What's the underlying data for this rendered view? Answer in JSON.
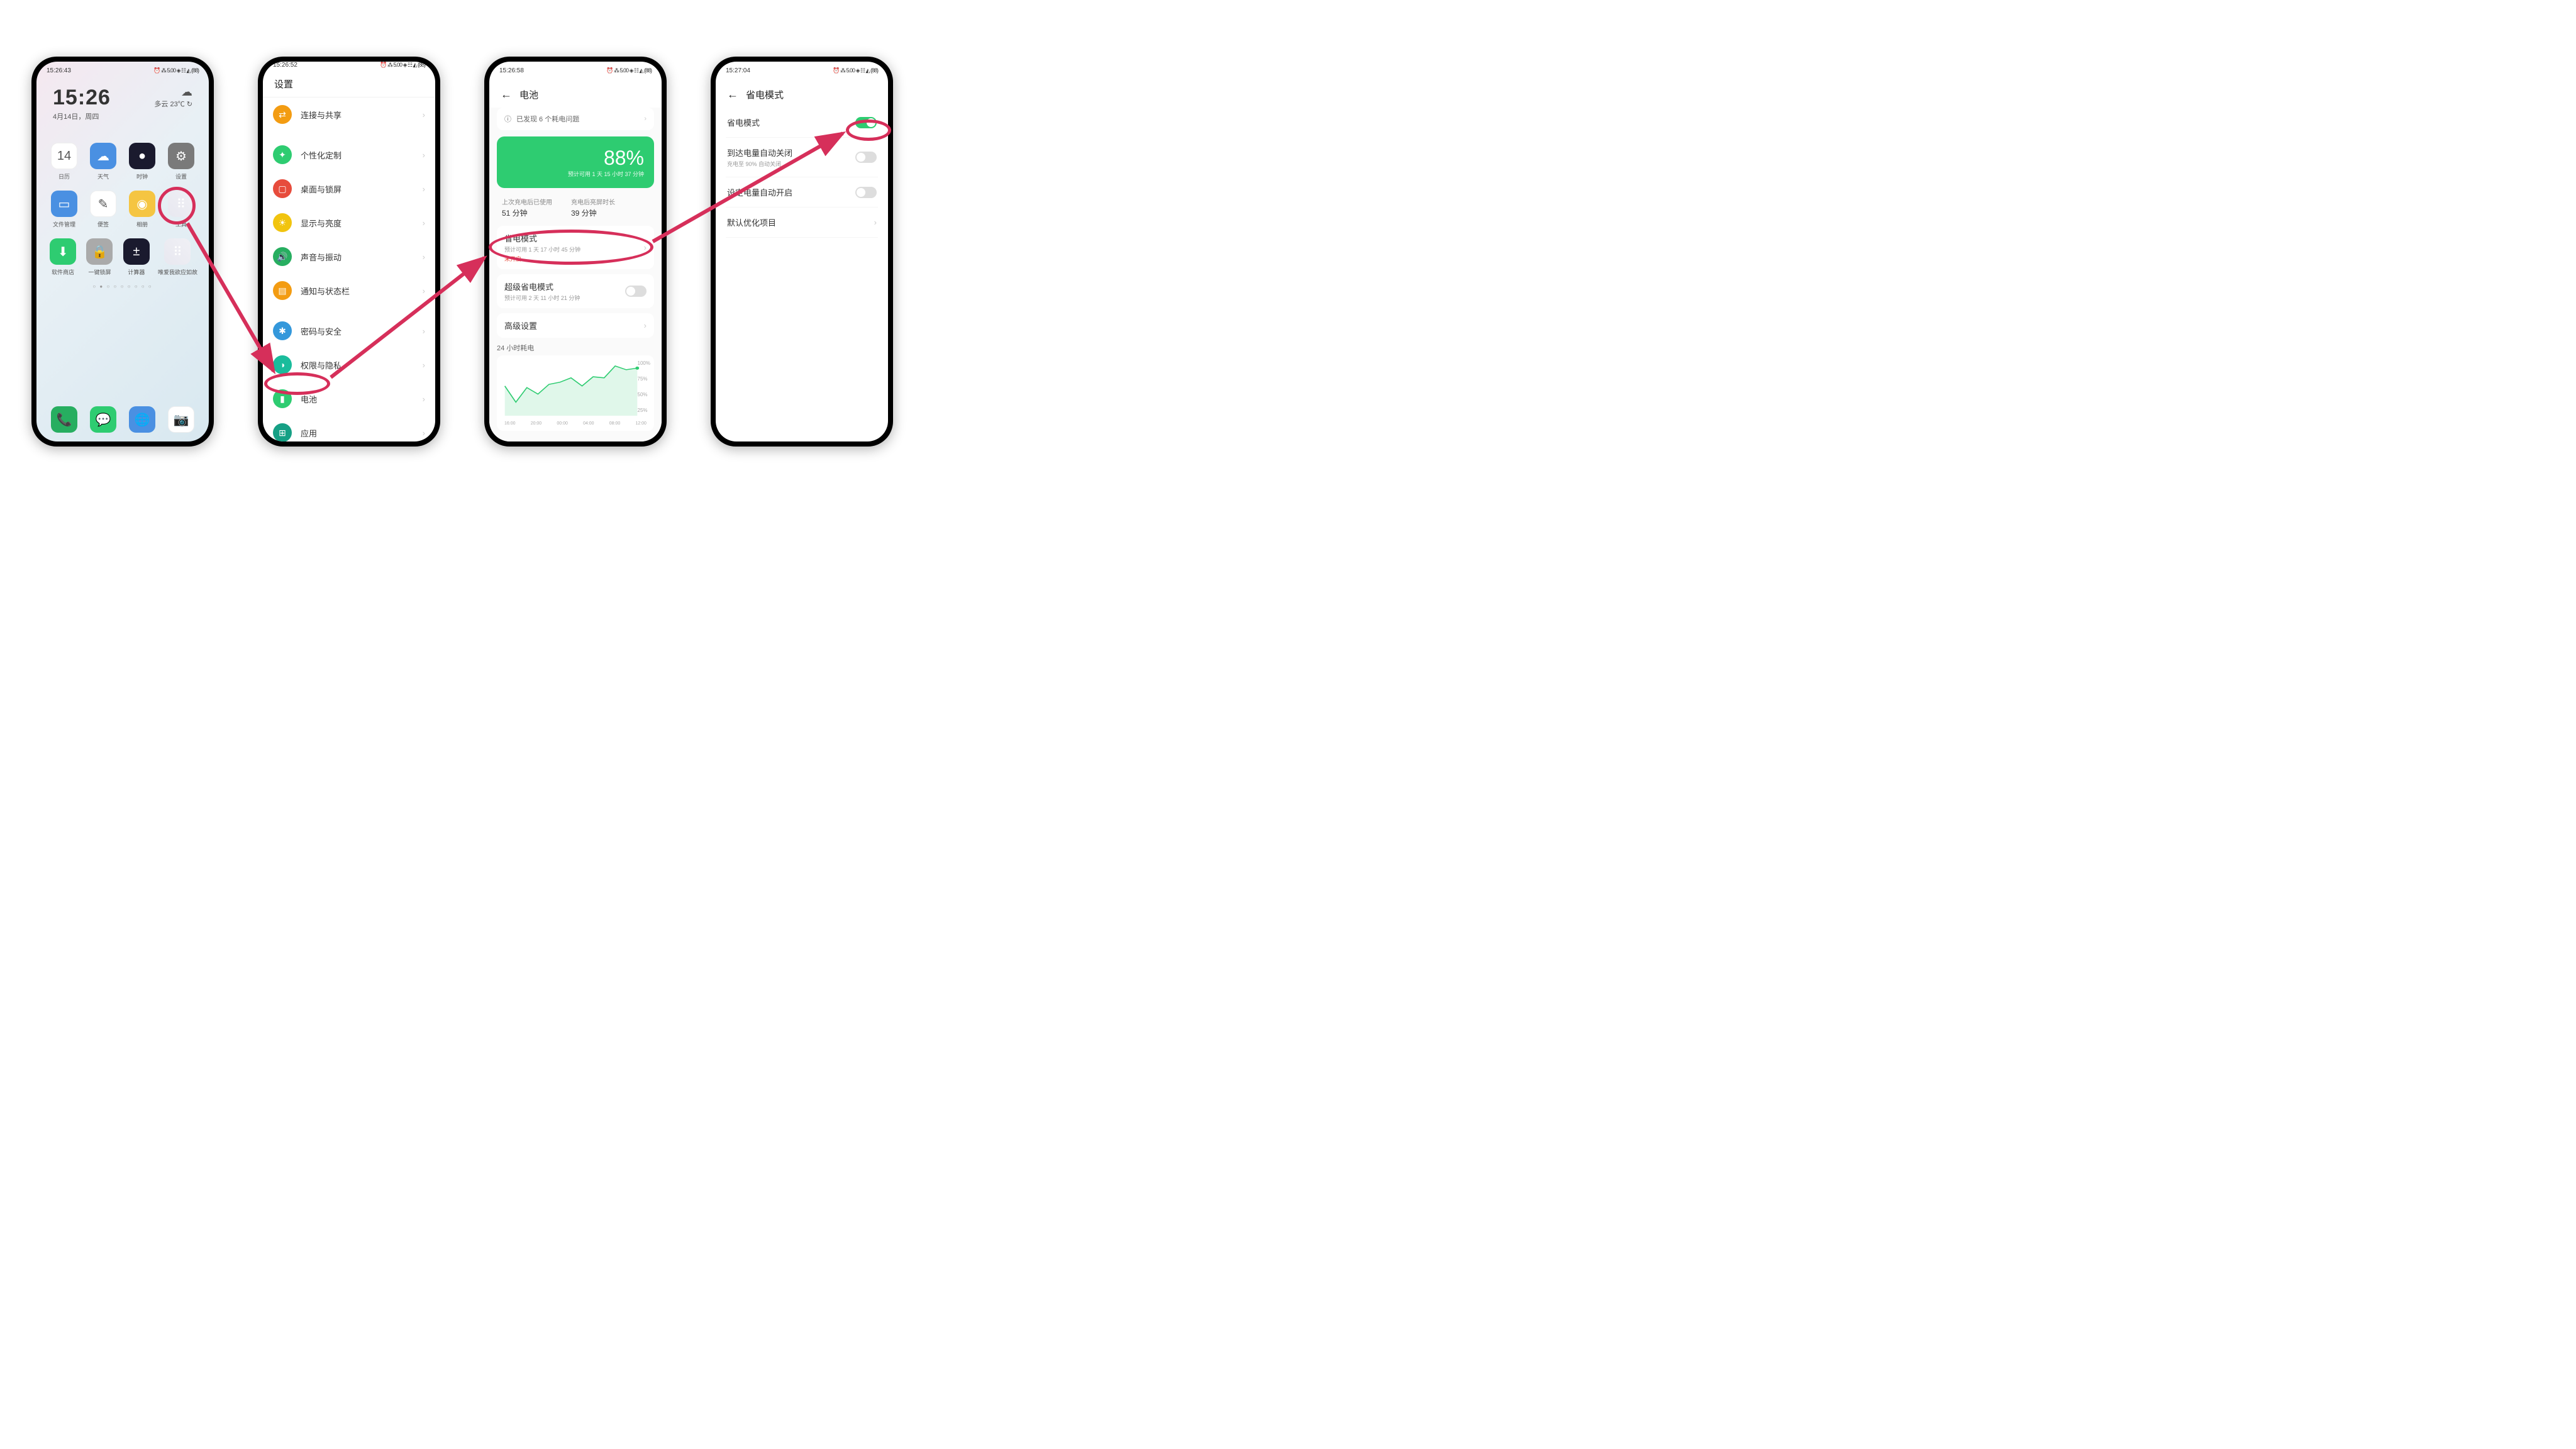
{
  "phone1": {
    "status_time": "15:26:43",
    "status_icons": "⏰ ⁂ 5.00 ◈ ☷ ◭ (88)",
    "clock": "15:26",
    "date": "4月14日，周四",
    "weather_text": "多云 23℃",
    "weather_refresh": "↻",
    "apps_row1": [
      {
        "icon": "14",
        "label": "日历",
        "c": "c-white"
      },
      {
        "icon": "☁",
        "label": "天气",
        "c": "c-blue"
      },
      {
        "icon": "●",
        "label": "时钟",
        "c": "c-dark"
      },
      {
        "icon": "⚙",
        "label": "设置",
        "c": "c-grey"
      }
    ],
    "apps_row2": [
      {
        "icon": "▭",
        "label": "文件管理",
        "c": "c-blue"
      },
      {
        "icon": "✎",
        "label": "便签",
        "c": "c-white"
      },
      {
        "icon": "◉",
        "label": "相册",
        "c": "c-yellow"
      },
      {
        "icon": "⠿",
        "label": "工具",
        "c": "c-folder"
      }
    ],
    "apps_row3": [
      {
        "icon": "⬇",
        "label": "软件商店",
        "c": "c-green"
      },
      {
        "icon": "🔒",
        "label": "一键锁屏",
        "c": "c-lgrey"
      },
      {
        "icon": "±",
        "label": "计算器",
        "c": "c-dark"
      },
      {
        "icon": "⠿",
        "label": "唯爱我欲应如故",
        "c": "c-folder"
      }
    ],
    "dock": [
      {
        "icon": "📞",
        "c": "c-green2"
      },
      {
        "icon": "💬",
        "c": "c-green"
      },
      {
        "icon": "🌐",
        "c": "c-blue"
      },
      {
        "icon": "📷",
        "c": "c-white"
      }
    ]
  },
  "phone2": {
    "status_time": "15:26:52",
    "status_icons": "⏰ ⁂ 5.00 ◈ ☷ ◭ (88)",
    "title": "设置",
    "groups": [
      [
        {
          "label": "连接与共享",
          "c": "ic-orange",
          "g": "⇄"
        }
      ],
      [
        {
          "label": "个性化定制",
          "c": "ic-green",
          "g": "✦"
        },
        {
          "label": "桌面与锁屏",
          "c": "ic-red",
          "g": "▢"
        },
        {
          "label": "显示与亮度",
          "c": "ic-yellow",
          "g": "☀"
        },
        {
          "label": "声音与振动",
          "c": "ic-green2",
          "g": "🔊"
        },
        {
          "label": "通知与状态栏",
          "c": "ic-orange",
          "g": "▤"
        }
      ],
      [
        {
          "label": "密码与安全",
          "c": "ic-blue",
          "g": "✱"
        },
        {
          "label": "权限与隐私",
          "c": "ic-cyan",
          "g": "◑"
        },
        {
          "label": "电池",
          "c": "ic-green",
          "g": "▮"
        },
        {
          "label": "应用",
          "c": "ic-teal",
          "g": "⊞"
        }
      ]
    ]
  },
  "phone3": {
    "status_time": "15:26:58",
    "status_icons": "⏰ ⁂ 5.00 ◈ ☷ ◭ (88)",
    "title": "电池",
    "alert": "已发现 6 个耗电问题",
    "pct": "88%",
    "pct_sub": "预计可用 1 天 15 小时 37 分钟",
    "stat1_l": "上次充电后已使用",
    "stat1_v": "51 分钟",
    "stat2_l": "充电后亮屏时长",
    "stat2_v": "39 分钟",
    "save_t": "省电模式",
    "save_s1": "预计可用 1 天 17 小时 45 分钟",
    "save_s2": "未开启",
    "super_t": "超级省电模式",
    "super_s": "预计可用 2 天 11 小时 21 分钟",
    "adv": "高级设置",
    "chart_title": "24 小时耗电"
  },
  "phone4": {
    "status_time": "15:27:04",
    "status_icons": "⏰ ⁂ 5.00 ◈ ☷ ◭ (88)",
    "title": "省电模式",
    "r1": "省电模式",
    "r2_t": "到达电量自动关闭",
    "r2_s": "充电至 90% 自动关闭",
    "r3": "设定电量自动开启",
    "r4": "默认优化项目"
  },
  "chart_data": {
    "type": "line",
    "title": "24 小时耗电",
    "ylabel": "",
    "xlabel": "",
    "ylim": [
      0,
      100
    ],
    "y_ticks": [
      "100%",
      "75%",
      "50%",
      "25%"
    ],
    "x_ticks": [
      "16:00",
      "20:00",
      "00:00",
      "04:00",
      "08:00",
      "12:00"
    ],
    "x": [
      "16:00",
      "18:00",
      "20:00",
      "22:00",
      "00:00",
      "02:00",
      "04:00",
      "06:00",
      "08:00",
      "10:00",
      "12:00",
      "14:00",
      "15:00"
    ],
    "values": [
      55,
      25,
      52,
      40,
      58,
      62,
      70,
      55,
      72,
      70,
      92,
      85,
      88
    ]
  },
  "colors": {
    "accent": "#2ecc71",
    "annotation": "#d62f5a"
  }
}
